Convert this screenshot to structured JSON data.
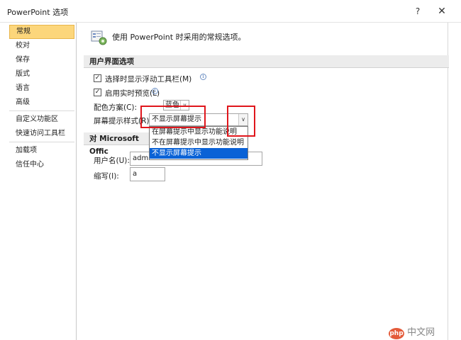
{
  "window": {
    "title": "PowerPoint 选项",
    "help_glyph": "?",
    "close_glyph": "✕"
  },
  "sidebar": {
    "items": [
      {
        "label": "常规",
        "active": true
      },
      {
        "label": "校对"
      },
      {
        "label": "保存"
      },
      {
        "label": "版式"
      },
      {
        "label": "语言"
      },
      {
        "label": "高级"
      },
      {
        "label": "自定义功能区"
      },
      {
        "label": "快速访问工具栏"
      },
      {
        "label": "加载项"
      },
      {
        "label": "信任中心"
      }
    ]
  },
  "header": {
    "text": "使用 PowerPoint 时采用的常规选项。"
  },
  "ui_section": {
    "title": "用户界面选项",
    "mini_toolbar_label": "选择时显示浮动工具栏(M)",
    "live_preview_label": "启用实时预览(L)",
    "color_scheme_label": "配色方案(C):",
    "color_scheme_value": "蓝色",
    "screentip_label": "屏幕提示样式(R):",
    "screentip_value": "不显示屏幕提示",
    "screentip_options": [
      "在屏幕提示中显示功能说明",
      "不在屏幕提示中显示功能说明",
      "不显示屏幕提示"
    ],
    "screentip_selected_index": 2
  },
  "personalize_section": {
    "title": "对 Microsoft Offic",
    "username_label": "用户名(U):",
    "username_value": "admin",
    "initials_label": "缩写(I):",
    "initials_value": "a"
  },
  "watermark": {
    "logo": "php",
    "text": "中文网"
  },
  "icons": {
    "checkbox": "checkbox-checked-icon",
    "info": "info-icon",
    "arrow": "chevron-down-icon"
  },
  "colors": {
    "active_item_bg": "#fcd67b",
    "selected_option_bg": "#0a62d6",
    "highlight_box": "#e0161c"
  }
}
